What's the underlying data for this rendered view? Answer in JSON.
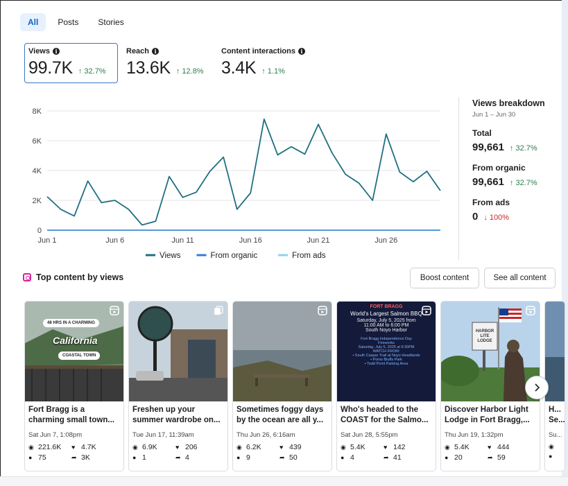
{
  "tabs": [
    "All",
    "Posts",
    "Stories"
  ],
  "metrics": [
    {
      "label": "Views",
      "value": "99.7K",
      "change": "↑ 32.7%"
    },
    {
      "label": "Reach",
      "value": "13.6K",
      "change": "↑ 12.8%"
    },
    {
      "label": "Content interactions",
      "value": "3.4K",
      "change": "↑ 1.1%"
    }
  ],
  "chart_data": {
    "type": "line",
    "x": [
      1,
      2,
      3,
      4,
      5,
      6,
      7,
      8,
      9,
      10,
      11,
      12,
      13,
      14,
      15,
      16,
      17,
      18,
      19,
      20,
      21,
      22,
      23,
      24,
      25,
      26,
      27,
      28,
      29,
      30
    ],
    "x_tick_labels": [
      "Jun 1",
      "Jun 6",
      "Jun 11",
      "Jun 16",
      "Jun 21",
      "Jun 26"
    ],
    "x_tick_positions": [
      1,
      6,
      11,
      16,
      21,
      26
    ],
    "y_tick_labels": [
      "0",
      "2K",
      "4K",
      "6K",
      "8K"
    ],
    "ylim": [
      0,
      8000
    ],
    "grid": true,
    "legend_position": "bottom",
    "series": [
      {
        "name": "Views",
        "color": "#1f6f80",
        "values": [
          2250,
          1400,
          950,
          3300,
          1850,
          2000,
          1400,
          350,
          600,
          3600,
          2200,
          2550,
          3950,
          4900,
          1400,
          2500,
          7450,
          5050,
          5600,
          5100,
          7100,
          5200,
          3750,
          3150,
          2000,
          6450,
          3900,
          3250,
          3950,
          2650
        ]
      },
      {
        "name": "From organic",
        "color": "#2d7fd1",
        "values": [
          0,
          0,
          0,
          0,
          0,
          0,
          0,
          0,
          0,
          0,
          0,
          0,
          0,
          0,
          0,
          0,
          0,
          0,
          0,
          0,
          0,
          0,
          0,
          0,
          0,
          0,
          0,
          0,
          0,
          0
        ]
      },
      {
        "name": "From ads",
        "color": "#8fd3ec",
        "values": [
          0,
          0,
          0,
          0,
          0,
          0,
          0,
          0,
          0,
          0,
          0,
          0,
          0,
          0,
          0,
          0,
          0,
          0,
          0,
          0,
          0,
          0,
          0,
          0,
          0,
          0,
          0,
          0,
          0,
          0
        ]
      }
    ]
  },
  "breakdown": {
    "title": "Views breakdown",
    "range": "Jun 1 – Jun 30",
    "total_label": "Total",
    "total_value": "99,661",
    "total_change": "↑ 32.7%",
    "organic_label": "From organic",
    "organic_value": "99,661",
    "organic_change": "↑ 32.7%",
    "ads_label": "From ads",
    "ads_value": "0",
    "ads_change": "↓ 100%"
  },
  "top_content": {
    "title": "Top content by views",
    "boost_label": "Boost content",
    "see_all_label": "See all content",
    "cards": [
      {
        "title": "Fort Bragg is a charming small town...",
        "date": "Sat Jun 7, 1:08pm",
        "views": "221.6K",
        "likes": "4.7K",
        "comments": "75",
        "shares": "3K",
        "type_icon": "reel-icon",
        "overlay": [
          "48 HRS IN A CHARMING",
          "California",
          "COASTAL TOWN"
        ]
      },
      {
        "title": "Freshen up your summer wardrobe on...",
        "date": "Tue Jun 17, 11:39am",
        "views": "6.9K",
        "likes": "206",
        "comments": "1",
        "shares": "4",
        "type_icon": "carousel-icon"
      },
      {
        "title": "Sometimes foggy days by the ocean are all y...",
        "date": "Thu Jun 26, 6:16am",
        "views": "6.2K",
        "likes": "439",
        "comments": "9",
        "shares": "50",
        "type_icon": "reel-icon"
      },
      {
        "title": "Who's headed to the COAST for the Salmo...",
        "date": "Sat Jun 28, 5:55pm",
        "views": "5.4K",
        "likes": "142",
        "comments": "4",
        "shares": "41",
        "type_icon": "reel-icon",
        "overlay": [
          "FORT BRAGG",
          "World's Largest Salmon BBQ",
          "Saturday, July 5, 2025 from",
          "11:00 AM to 6:00 PM",
          "South Noyo Harbor",
          "Fort Bragg Independence Day",
          "Fireworks",
          "Saturday, July 5, 2025 at 9:30PM",
          "WATCH FROM:",
          "• South Caspar Trail at Noyo Headlands",
          "• Pomo Bluffs Park",
          "• Todd Point Parking Area"
        ]
      },
      {
        "title": "Discover Harbor Light Lodge in Fort Bragg,...",
        "date": "Thu Jun 19, 1:32pm",
        "views": "5.4K",
        "likes": "444",
        "comments": "20",
        "shares": "59",
        "type_icon": "reel-icon",
        "overlay": [
          "HARBOR LITE LODGE"
        ]
      },
      {
        "title": "H... Se...",
        "date": "Su...",
        "views": "",
        "likes": "",
        "comments": "",
        "shares": "",
        "type_icon": ""
      }
    ]
  }
}
